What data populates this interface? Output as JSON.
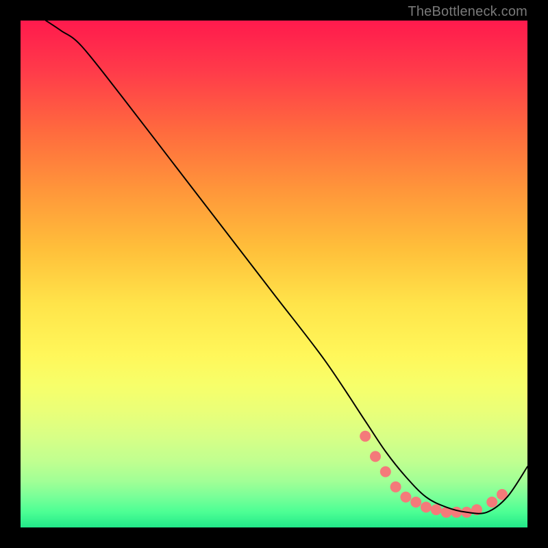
{
  "attribution": "TheBottleneck.com",
  "chart_data": {
    "type": "line",
    "title": "",
    "xlabel": "",
    "ylabel": "",
    "xlim": [
      0,
      100
    ],
    "ylim": [
      0,
      100
    ],
    "grid": false,
    "legend": false,
    "series": [
      {
        "name": "curve",
        "x": [
          5,
          8,
          12,
          20,
          30,
          40,
          50,
          60,
          68,
          72,
          76,
          80,
          84,
          88,
          92,
          96,
          100
        ],
        "y": [
          100,
          98,
          95,
          85,
          72,
          59,
          46,
          33,
          21,
          15,
          10,
          6,
          4,
          3,
          3,
          6,
          12
        ],
        "color": "#000000",
        "stroke_width": 2
      }
    ],
    "marker_cluster": {
      "note": "salmon dotted markers near curve minimum",
      "color": "#f47a7a",
      "radius": 8,
      "points": [
        {
          "x": 68,
          "y": 18
        },
        {
          "x": 70,
          "y": 14
        },
        {
          "x": 72,
          "y": 11
        },
        {
          "x": 74,
          "y": 8
        },
        {
          "x": 76,
          "y": 6
        },
        {
          "x": 78,
          "y": 5
        },
        {
          "x": 80,
          "y": 4
        },
        {
          "x": 82,
          "y": 3.5
        },
        {
          "x": 84,
          "y": 3
        },
        {
          "x": 86,
          "y": 3
        },
        {
          "x": 88,
          "y": 3
        },
        {
          "x": 90,
          "y": 3.5
        },
        {
          "x": 93,
          "y": 5
        },
        {
          "x": 95,
          "y": 6.5
        }
      ]
    }
  }
}
